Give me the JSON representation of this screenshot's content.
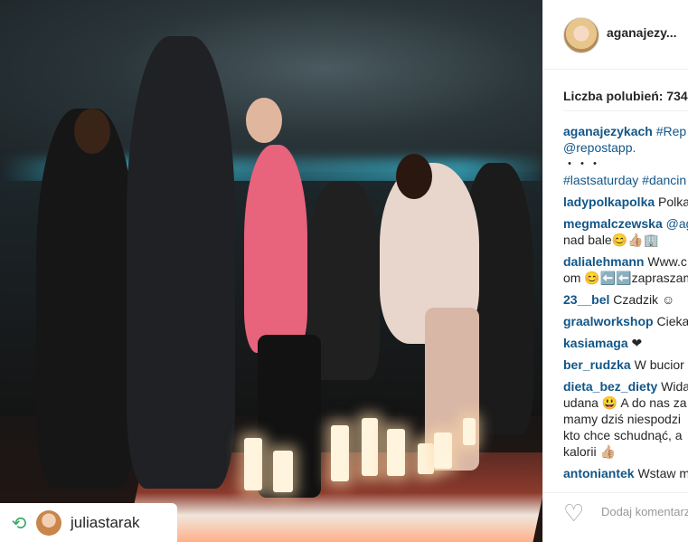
{
  "post": {
    "repost_icon": "repost-icon",
    "repost_username": "juliastarak"
  },
  "sidebar": {
    "username": "aganajezy...",
    "likes": "Liczba polubień: 734",
    "comments": [
      {
        "user": "aganajezykach",
        "lines": [
          "#Rep",
          "@repostapp.",
          "・・・",
          "#lastsaturday #dancin"
        ]
      },
      {
        "user": "ladypolkapolka",
        "lines": [
          "Polka"
        ]
      },
      {
        "user": "megmalczewska",
        "lines": [
          "@ag",
          "nad bale😊👍🏼🏢"
        ]
      },
      {
        "user": "dalialehmann",
        "lines": [
          "Www.c",
          "om 😊⬅️⬅️zapraszam"
        ]
      },
      {
        "user": "23__bel",
        "lines": [
          "Czadzik ☺"
        ]
      },
      {
        "user": "graalworkshop",
        "lines": [
          "Cieka"
        ]
      },
      {
        "user": "kasiamaga",
        "lines": [
          "❤"
        ]
      },
      {
        "user": "ber_rudzka",
        "lines": [
          "W bucior"
        ]
      },
      {
        "user": "dieta_bez_diety",
        "lines": [
          "Wida",
          "udana 😃 A do nas za",
          "mamy dziś niespodzi",
          "kto chce schudnąć, a",
          "kalorii 👍🏼"
        ]
      },
      {
        "user": "antoniantek",
        "lines": [
          "Wstaw m"
        ]
      }
    ],
    "heart_icon": "heart-icon",
    "comment_placeholder": "Dodaj komentarz..."
  }
}
